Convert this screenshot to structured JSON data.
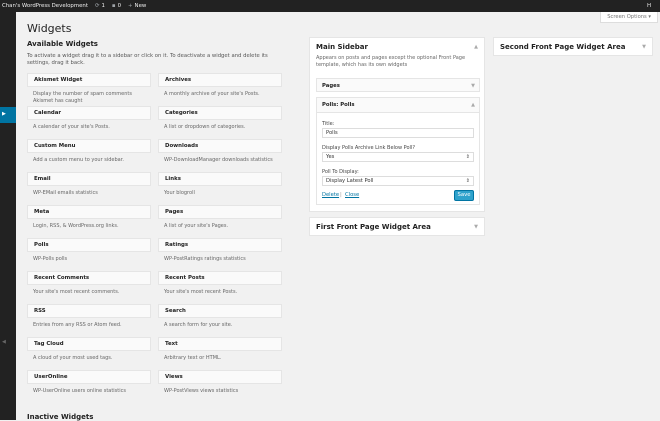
{
  "admin_bar": {
    "site_name": "Chan's WordPress Development",
    "updates_count": "1",
    "comments_count": "0",
    "new_label": "New",
    "howdy": "H"
  },
  "screen_options": "Screen Options ▾",
  "page_title": "Widgets",
  "available": {
    "heading": "Available Widgets",
    "description": "To activate a widget drag it to a sidebar or click on it. To deactivate a widget and delete its settings, drag it back."
  },
  "widgets": [
    {
      "title": "Akismet Widget",
      "desc": "Display the number of spam comments Akismet has caught"
    },
    {
      "title": "Archives",
      "desc": "A monthly archive of your site's Posts."
    },
    {
      "title": "Calendar",
      "desc": "A calendar of your site's Posts."
    },
    {
      "title": "Categories",
      "desc": "A list or dropdown of categories."
    },
    {
      "title": "Custom Menu",
      "desc": "Add a custom menu to your sidebar."
    },
    {
      "title": "Downloads",
      "desc": "WP-DownloadManager downloads statistics"
    },
    {
      "title": "Email",
      "desc": "WP-EMail emails statistics"
    },
    {
      "title": "Links",
      "desc": "Your blogroll"
    },
    {
      "title": "Meta",
      "desc": "Login, RSS, & WordPress.org links."
    },
    {
      "title": "Pages",
      "desc": "A list of your site's Pages."
    },
    {
      "title": "Polls",
      "desc": "WP-Polls polls"
    },
    {
      "title": "Ratings",
      "desc": "WP-PostRatings ratings statistics"
    },
    {
      "title": "Recent Comments",
      "desc": "Your site's most recent comments."
    },
    {
      "title": "Recent Posts",
      "desc": "Your site's most recent Posts."
    },
    {
      "title": "RSS",
      "desc": "Entries from any RSS or Atom feed."
    },
    {
      "title": "Search",
      "desc": "A search form for your site."
    },
    {
      "title": "Tag Cloud",
      "desc": "A cloud of your most used tags."
    },
    {
      "title": "Text",
      "desc": "Arbitrary text or HTML."
    },
    {
      "title": "UserOnline",
      "desc": "WP-UserOnline users online statistics"
    },
    {
      "title": "Views",
      "desc": "WP-PostViews views statistics"
    }
  ],
  "inactive_heading": "Inactive Widgets",
  "main_sidebar": {
    "title": "Main Sidebar",
    "description": "Appears on posts and pages except the optional Front Page template, which has its own widgets",
    "pages_widget": "Pages",
    "polls_widget": {
      "header": "Polls: Polls",
      "title_label": "Title:",
      "title_value": "Polls",
      "archive_label": "Display Polls Archive Link Below Poll?",
      "archive_value": "Yes",
      "display_label": "Poll To Display:",
      "display_value": "Display Latest Poll",
      "delete_label": "Delete",
      "separator": "|",
      "close_label": "Close",
      "save_label": "Save"
    }
  },
  "first_front": {
    "title": "First Front Page Widget Area"
  },
  "second_front": {
    "title": "Second Front Page Widget Area"
  },
  "colors": {
    "accent": "#0074a2",
    "button": "#2ea2cc",
    "adminbar": "#222222",
    "background": "#f1f1f1"
  },
  "icons": [
    "wordpress-icon",
    "updates-icon",
    "comments-icon",
    "plus-icon",
    "appearance-icon",
    "toggle-arrow-icon"
  ]
}
